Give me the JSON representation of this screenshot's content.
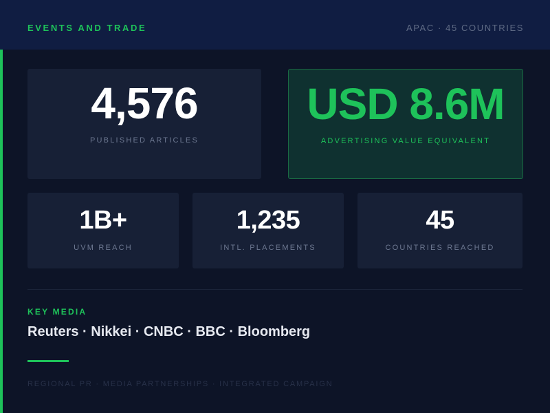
{
  "header": {
    "title": "EVENTS AND TRADE",
    "region": "APAC · 45 COUNTRIES"
  },
  "metrics_primary": [
    {
      "value": "4,576",
      "label": "PUBLISHED ARTICLES"
    },
    {
      "value": "USD 8.6M",
      "label": "ADVERTISING VALUE EQUIVALENT"
    }
  ],
  "metrics_secondary": [
    {
      "value": "1B+",
      "label": "UVM REACH"
    },
    {
      "value": "1,235",
      "label": "INTL. PLACEMENTS"
    },
    {
      "value": "45",
      "label": "COUNTRIES REACHED"
    }
  ],
  "key_media": {
    "label": "KEY MEDIA",
    "outlets": "Reuters · Nikkei · CNBC · BBC · Bloomberg"
  },
  "footer": {
    "text": "REGIONAL PR · MEDIA PARTNERSHIPS · INTEGRATED CAMPAIGN"
  },
  "colors": {
    "accent": "#1ec25a",
    "background": "#0d1427",
    "header_background": "#101d42",
    "card_background": "#172036",
    "highlight_card_background": "#0f3130"
  }
}
